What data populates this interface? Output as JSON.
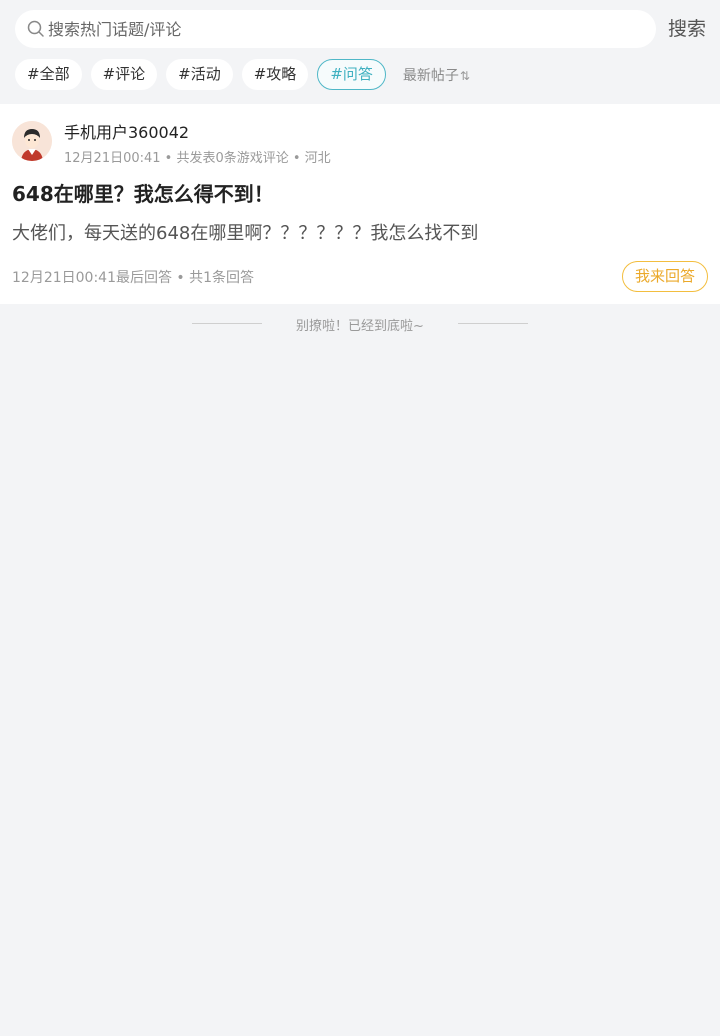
{
  "search": {
    "placeholder": "搜索热门话题/评论",
    "button_label": "搜索"
  },
  "tags": [
    {
      "label": "#全部",
      "active": false
    },
    {
      "label": "#评论",
      "active": false
    },
    {
      "label": "#活动",
      "active": false
    },
    {
      "label": "#攻略",
      "active": false
    },
    {
      "label": "#问答",
      "active": true
    }
  ],
  "sort": {
    "label": "最新帖子",
    "icon": "sort-icon"
  },
  "post": {
    "username": "手机用户360042",
    "meta": "12月21日00:41 • 共发表0条游戏评论 • 河北",
    "title": "648在哪里？我怎么得不到！",
    "body": "大佬们，每天送的648在哪里啊？？？？？？我怎么找不到",
    "footer": "12月21日00:41最后回答 • 共1条回答",
    "answer_label": "我来回答"
  },
  "end_text": "别撩啦！已经到底啦~",
  "colors": {
    "accent_teal": "#3fb0c0",
    "accent_orange": "#eba92a",
    "background": "#f3f4f6"
  }
}
